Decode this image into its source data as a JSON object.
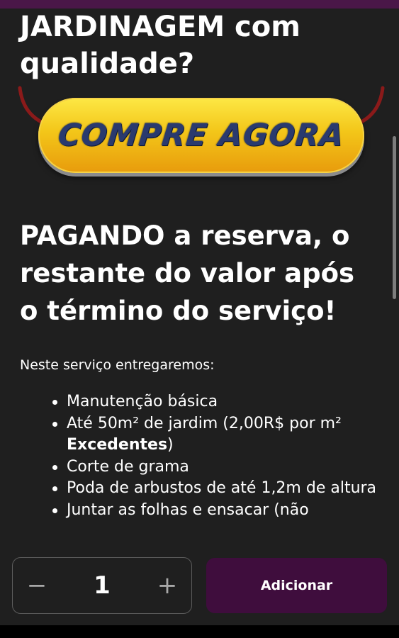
{
  "heading_top": "JARDINAGEM com qualidade?",
  "cta_button": {
    "label": "COMPRE AGORA",
    "colors": {
      "top": "#fde845",
      "bottom": "#e89b0c",
      "text": "#2a3a6e",
      "arrows": "#8b1a1a"
    }
  },
  "heading_payment": "PAGANDO a reserva, o restante do valor após o término do serviço!",
  "intro_text": "Neste serviço entregaremos:",
  "features": [
    {
      "text": "Manutenção básica"
    },
    {
      "text": "Até 50m² de jardim (2,00R$ por m² ",
      "bold": "Excedentes",
      "after": ")"
    },
    {
      "text": "Corte de grama"
    },
    {
      "text": "Poda de arbustos de até 1,2m de altura"
    },
    {
      "text": "Juntar as folhas e ensacar (não"
    }
  ],
  "quantity": {
    "minus_label": "−",
    "value": "1",
    "plus_label": "+"
  },
  "add_button": {
    "label": "Adicionar",
    "color": "#3f0d3d"
  },
  "accent": "#4a1748"
}
